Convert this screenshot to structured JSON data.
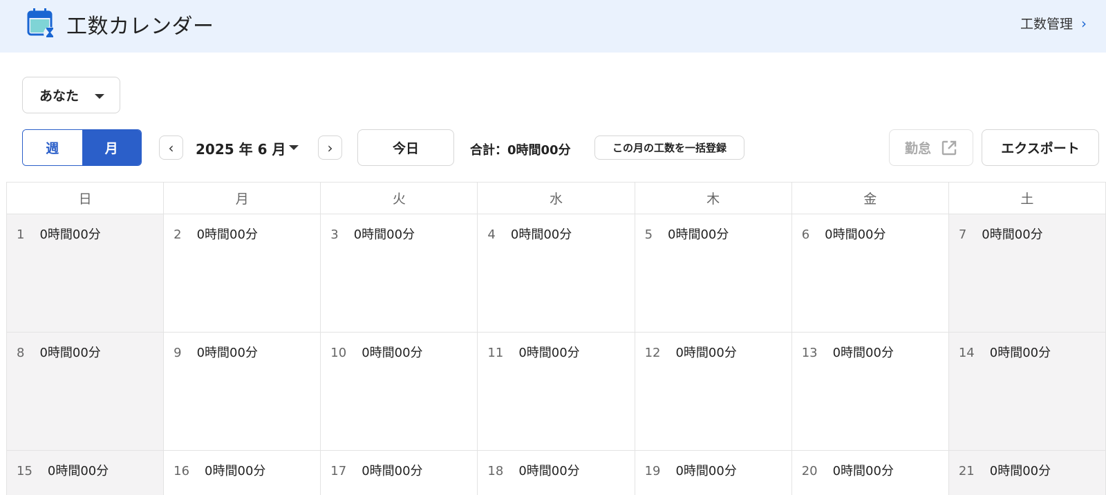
{
  "header": {
    "title": "工数カレンダー",
    "manage_link": "工数管理",
    "chevron": "›"
  },
  "user_select": {
    "value": "あなた"
  },
  "view_toggle": {
    "week": "週",
    "month": "月",
    "selected": "month"
  },
  "nav": {
    "prev": "‹",
    "next": "›",
    "month_label": "2025 年 6 月"
  },
  "today_label": "今日",
  "total_label": "合計：0時間00分",
  "bulk_register_label": "この月の工数を一括登録",
  "attendance_label": "勤怠",
  "export_label": "エクスポート",
  "calendar": {
    "weekdays": [
      "日",
      "月",
      "火",
      "水",
      "木",
      "金",
      "土"
    ],
    "weeks": [
      [
        {
          "day": "1",
          "hours": "0時間00分"
        },
        {
          "day": "2",
          "hours": "0時間00分"
        },
        {
          "day": "3",
          "hours": "0時間00分"
        },
        {
          "day": "4",
          "hours": "0時間00分"
        },
        {
          "day": "5",
          "hours": "0時間00分"
        },
        {
          "day": "6",
          "hours": "0時間00分"
        },
        {
          "day": "7",
          "hours": "0時間00分"
        }
      ],
      [
        {
          "day": "8",
          "hours": "0時間00分"
        },
        {
          "day": "9",
          "hours": "0時間00分"
        },
        {
          "day": "10",
          "hours": "0時間00分"
        },
        {
          "day": "11",
          "hours": "0時間00分"
        },
        {
          "day": "12",
          "hours": "0時間00分"
        },
        {
          "day": "13",
          "hours": "0時間00分"
        },
        {
          "day": "14",
          "hours": "0時間00分"
        }
      ],
      [
        {
          "day": "15",
          "hours": "0時間00分"
        },
        {
          "day": "16",
          "hours": "0時間00分"
        },
        {
          "day": "17",
          "hours": "0時間00分"
        },
        {
          "day": "18",
          "hours": "0時間00分"
        },
        {
          "day": "19",
          "hours": "0時間00分"
        },
        {
          "day": "20",
          "hours": "0時間00分"
        },
        {
          "day": "21",
          "hours": "0時間00分"
        }
      ]
    ]
  },
  "colors": {
    "header_bg": "#eaf2fd",
    "accent": "#2b5fc9",
    "weekend_bg": "#f4f3f4"
  }
}
